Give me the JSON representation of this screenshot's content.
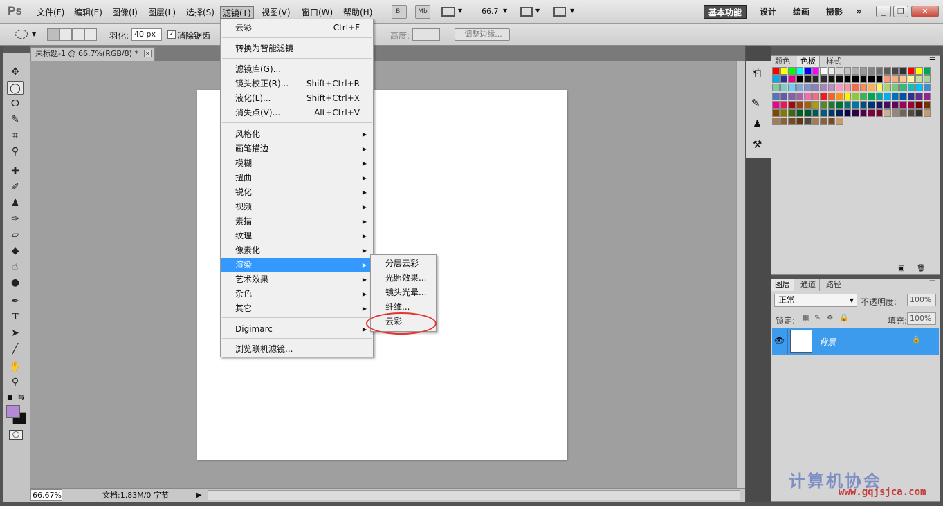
{
  "menubar": {
    "logo": "Ps",
    "items": [
      "文件(F)",
      "编辑(E)",
      "图像(I)",
      "图层(L)",
      "选择(S)",
      "滤镜(T)",
      "视图(V)",
      "窗口(W)",
      "帮助(H)"
    ],
    "bridge_btn": "Br",
    "minibridge_btn": "Mb",
    "zoom_value": "66.7",
    "workspaces": [
      "基本功能",
      "设计",
      "绘画",
      "摄影"
    ],
    "more": "»"
  },
  "options": {
    "feather_label": "羽化:",
    "feather_value": "40 px",
    "antialias_label": "消除锯齿",
    "antialias_checked": true,
    "height_label": "高度:",
    "refine_edge": "调整边缘..."
  },
  "document": {
    "tab_title": "未标题-1 @ 66.7%(RGB/8) *",
    "zoom": "66.67%",
    "doc_info": "文档:1.83M/0 字节"
  },
  "filter_menu": {
    "items": [
      {
        "label": "云彩",
        "shortcut": "Ctrl+F"
      },
      {
        "label": "转换为智能滤镜"
      },
      {
        "label": "滤镜库(G)..."
      },
      {
        "label": "镜头校正(R)...",
        "shortcut": "Shift+Ctrl+R"
      },
      {
        "label": "液化(L)...",
        "shortcut": "Shift+Ctrl+X"
      },
      {
        "label": "消失点(V)...",
        "shortcut": "Alt+Ctrl+V"
      },
      {
        "label": "风格化"
      },
      {
        "label": "画笔描边"
      },
      {
        "label": "模糊"
      },
      {
        "label": "扭曲"
      },
      {
        "label": "锐化"
      },
      {
        "label": "视频"
      },
      {
        "label": "素描"
      },
      {
        "label": "纹理"
      },
      {
        "label": "像素化"
      },
      {
        "label": "渲染"
      },
      {
        "label": "艺术效果"
      },
      {
        "label": "杂色"
      },
      {
        "label": "其它"
      },
      {
        "label": "Digimarc"
      },
      {
        "label": "浏览联机滤镜..."
      }
    ]
  },
  "render_submenu": {
    "items": [
      "分层云彩",
      "光照效果...",
      "镜头光晕...",
      "纤维...",
      "云彩"
    ]
  },
  "swatch_panel": {
    "tabs": [
      "颜色",
      "色板",
      "样式"
    ]
  },
  "layers_panel": {
    "tabs": [
      "图层",
      "通道",
      "路径"
    ],
    "blend_mode": "正常",
    "opacity_label": "不透明度:",
    "opacity": "100%",
    "lock_label": "锁定:",
    "fill_label": "填充:",
    "fill": "100%",
    "layer_name": "背景"
  },
  "colors": {
    "accent": "#3399ff",
    "foreground": "#b48ad8",
    "background": "#111111",
    "highlight_circle": "#e3342f"
  },
  "watermark": {
    "text": "计算机协会",
    "url": "www.gqjsjca.com"
  }
}
